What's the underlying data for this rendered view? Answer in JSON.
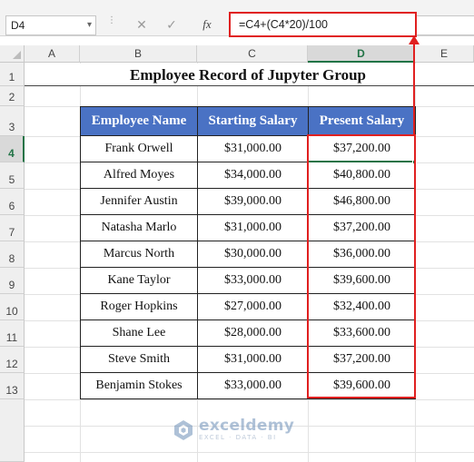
{
  "formula_bar": {
    "name_box": "D4",
    "formula": "=C4+(C4*20)/100",
    "cancel_icon": "close-icon",
    "enter_icon": "checkmark-icon",
    "fx_label": "fx"
  },
  "columns": [
    "A",
    "B",
    "C",
    "D",
    "E"
  ],
  "rows": [
    "1",
    "2",
    "3",
    "4",
    "5",
    "6",
    "7",
    "8",
    "9",
    "10",
    "11",
    "12",
    "13"
  ],
  "selected_cell": {
    "column": "D",
    "row": "4"
  },
  "sheet": {
    "title": "Employee Record of Jupyter Group",
    "headers": [
      "Employee Name",
      "Starting Salary",
      "Present Salary"
    ],
    "records": [
      [
        "Frank Orwell",
        "$31,000.00",
        "$37,200.00"
      ],
      [
        "Alfred Moyes",
        "$34,000.00",
        "$40,800.00"
      ],
      [
        "Jennifer Austin",
        "$39,000.00",
        "$46,800.00"
      ],
      [
        "Natasha Marlo",
        "$31,000.00",
        "$37,200.00"
      ],
      [
        "Marcus North",
        "$30,000.00",
        "$36,000.00"
      ],
      [
        "Kane Taylor",
        "$33,000.00",
        "$39,600.00"
      ],
      [
        "Roger Hopkins",
        "$27,000.00",
        "$32,400.00"
      ],
      [
        "Shane Lee",
        "$28,000.00",
        "$33,600.00"
      ],
      [
        "Steve Smith",
        "$31,000.00",
        "$37,200.00"
      ],
      [
        "Benjamin Stokes",
        "$33,000.00",
        "$39,600.00"
      ]
    ]
  },
  "colors": {
    "header_fill": "#4a72c4",
    "highlight": "#e02020",
    "selection": "#217346"
  },
  "watermark": {
    "name": "exceldemy",
    "tagline": "EXCEL · DATA · BI"
  }
}
